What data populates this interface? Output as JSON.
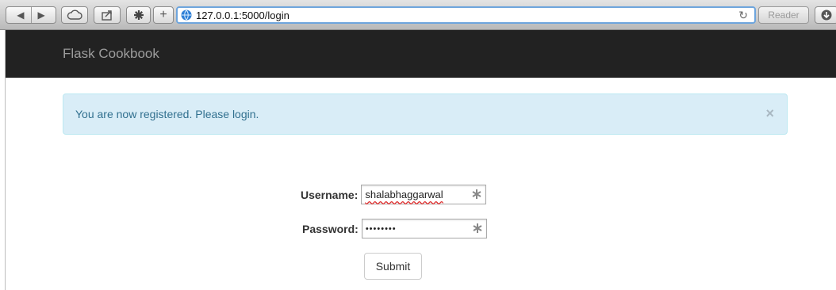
{
  "browser": {
    "url": "127.0.0.1:5000/login",
    "reader_label": "Reader",
    "back_icon": "back-arrow-icon",
    "forward_icon": "forward-arrow-icon",
    "reload_icon": "reload-icon"
  },
  "navbar": {
    "brand": "Flask Cookbook",
    "background": "#222222"
  },
  "alert": {
    "message": "You are now registered. Please login.",
    "close_glyph": "×",
    "background": "#d9edf7",
    "text_color": "#31708f"
  },
  "form": {
    "username_label": "Username:",
    "username_value": "shalabhaggarwal",
    "password_label": "Password:",
    "password_value": "••••••••",
    "submit_label": "Submit"
  }
}
